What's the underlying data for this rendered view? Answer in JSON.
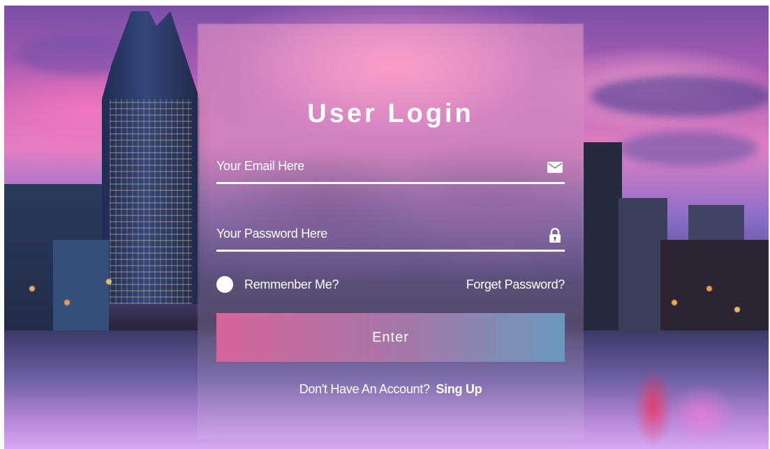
{
  "login": {
    "title": "User Login",
    "email_placeholder": "Your Email Here",
    "password_placeholder": "Your Password Here",
    "remember_label": "Remmenber Me?",
    "forget_label": "Forget Password?",
    "enter_label": "Enter",
    "no_account_text": "Don't Have An Account?",
    "signup_label": "Sing Up"
  },
  "icons": {
    "email": "envelope-icon",
    "password": "lock-icon"
  },
  "colors": {
    "button_gradient_start": "#d4659a",
    "button_gradient_end": "#6a98bd",
    "text": "#ffffff"
  }
}
